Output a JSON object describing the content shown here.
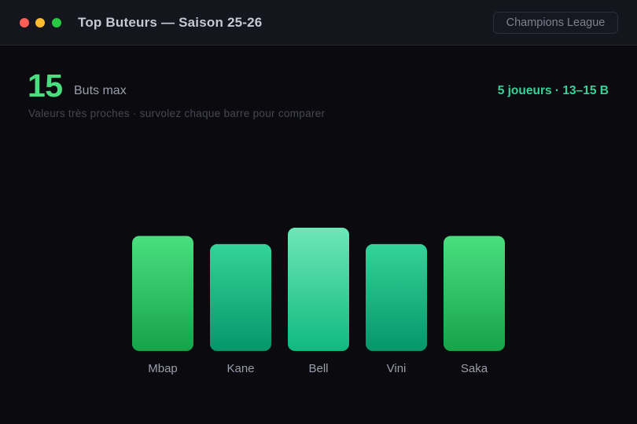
{
  "window": {
    "title": "Top Buteurs — Saison 25-26",
    "filter_label": "Champions League"
  },
  "kpi": {
    "value": "15",
    "label": "Buts max",
    "summary": "5 joueurs · 13–15 B",
    "subtitle": "Valeurs très proches · survolez chaque barre pour comparer"
  },
  "colors": {
    "accent": "#4ade80",
    "accent_teal": "#34d399"
  },
  "chart_data": {
    "type": "bar",
    "categories": [
      "Mbap",
      "Kane",
      "Bell",
      "Vini",
      "Saka"
    ],
    "values": [
      14,
      13,
      15,
      13,
      14
    ],
    "ylim": [
      0,
      15
    ],
    "grid": false,
    "legend": "none",
    "bar_colors": [
      [
        "#4ade80",
        "#16a34a"
      ],
      [
        "#34d399",
        "#059669"
      ],
      [
        "#6ee7b7",
        "#10b981"
      ],
      [
        "#34d399",
        "#059669"
      ],
      [
        "#4ade80",
        "#16a34a"
      ]
    ]
  }
}
